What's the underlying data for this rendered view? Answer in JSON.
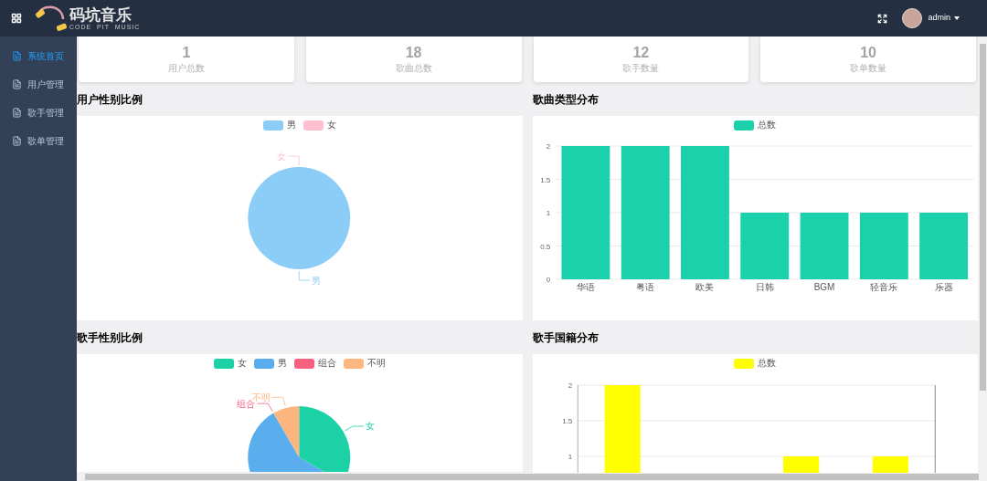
{
  "header": {
    "logo_title": "码坑音乐",
    "logo_subtitle": "CODE  PIT  MUSIC",
    "user": "admin"
  },
  "sidebar": {
    "items": [
      {
        "label": "系统首页",
        "selected": true
      },
      {
        "label": "用户管理",
        "selected": false
      },
      {
        "label": "歌手管理",
        "selected": false
      },
      {
        "label": "歌单管理",
        "selected": false
      }
    ]
  },
  "stats": [
    {
      "value": "1",
      "label": "用户总数"
    },
    {
      "value": "18",
      "label": "歌曲总数"
    },
    {
      "value": "12",
      "label": "歌手数量"
    },
    {
      "value": "10",
      "label": "歌单数量"
    }
  ],
  "panels": [
    {
      "title": "用户性别比例",
      "legend": [
        {
          "label": "男",
          "color": "#8ccdf8",
          "callout": "男"
        },
        {
          "label": "女",
          "color": "#ffbfcf",
          "callout": "女"
        }
      ],
      "chart_data": {
        "type": "pie",
        "values": [
          100,
          0
        ]
      }
    },
    {
      "title": "歌曲类型分布",
      "chart_data": {
        "type": "bar",
        "categories": [
          "华语",
          "粤语",
          "欧美",
          "日韩",
          "BGM",
          "轻音乐",
          "乐器"
        ],
        "series": [
          {
            "name": "总数",
            "color": "#1bd1ab",
            "values": [
              2,
              2,
              2,
              1,
              1,
              1,
              1
            ]
          }
        ],
        "ylim": [
          0,
          2
        ],
        "yticks": [
          0,
          0.5,
          1,
          1.5,
          2
        ],
        "grid": true
      }
    },
    {
      "title": "歌手性别比例",
      "legend": [
        {
          "label": "女",
          "color": "#1bd1a5",
          "callout": "女"
        },
        {
          "label": "男",
          "color": "#5aaeed"
        },
        {
          "label": "组合",
          "color": "#f7617f",
          "callout": "组合"
        },
        {
          "label": "不明",
          "color": "#fdb680",
          "callout": "不明"
        }
      ],
      "chart_data": {
        "type": "pie",
        "values": [
          33.33,
          58.33,
          0,
          8.34
        ]
      }
    },
    {
      "title": "歌手国籍分布",
      "chart_data": {
        "type": "bar",
        "series": [
          {
            "name": "总数",
            "color": "#ffff00",
            "values": [
              2,
              null,
              1,
              1
            ]
          }
        ],
        "ylim": [
          0,
          2
        ],
        "yticks": [
          1,
          1.5,
          2
        ],
        "grid": true
      }
    }
  ]
}
